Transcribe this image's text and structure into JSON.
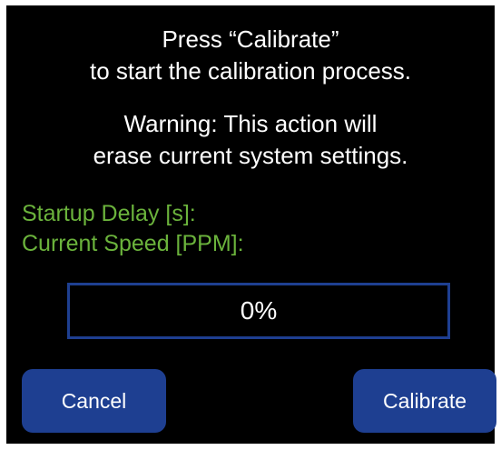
{
  "instruction": {
    "line1": "Press “Calibrate”",
    "line2": "to start the calibration process."
  },
  "warning": {
    "line1": "Warning:  This action will",
    "line2": "erase current system settings."
  },
  "parameters": {
    "startup_delay_label": "Startup Delay [s]:",
    "current_speed_label": "Current Speed [PPM]:"
  },
  "progress": {
    "value_text": "0%",
    "fraction": 0
  },
  "buttons": {
    "cancel_label": "Cancel",
    "calibrate_label": "Calibrate"
  },
  "colors": {
    "background": "#000000",
    "accent_blue": "#1e3f91",
    "label_green": "#6bb33c",
    "text": "#ffffff"
  }
}
